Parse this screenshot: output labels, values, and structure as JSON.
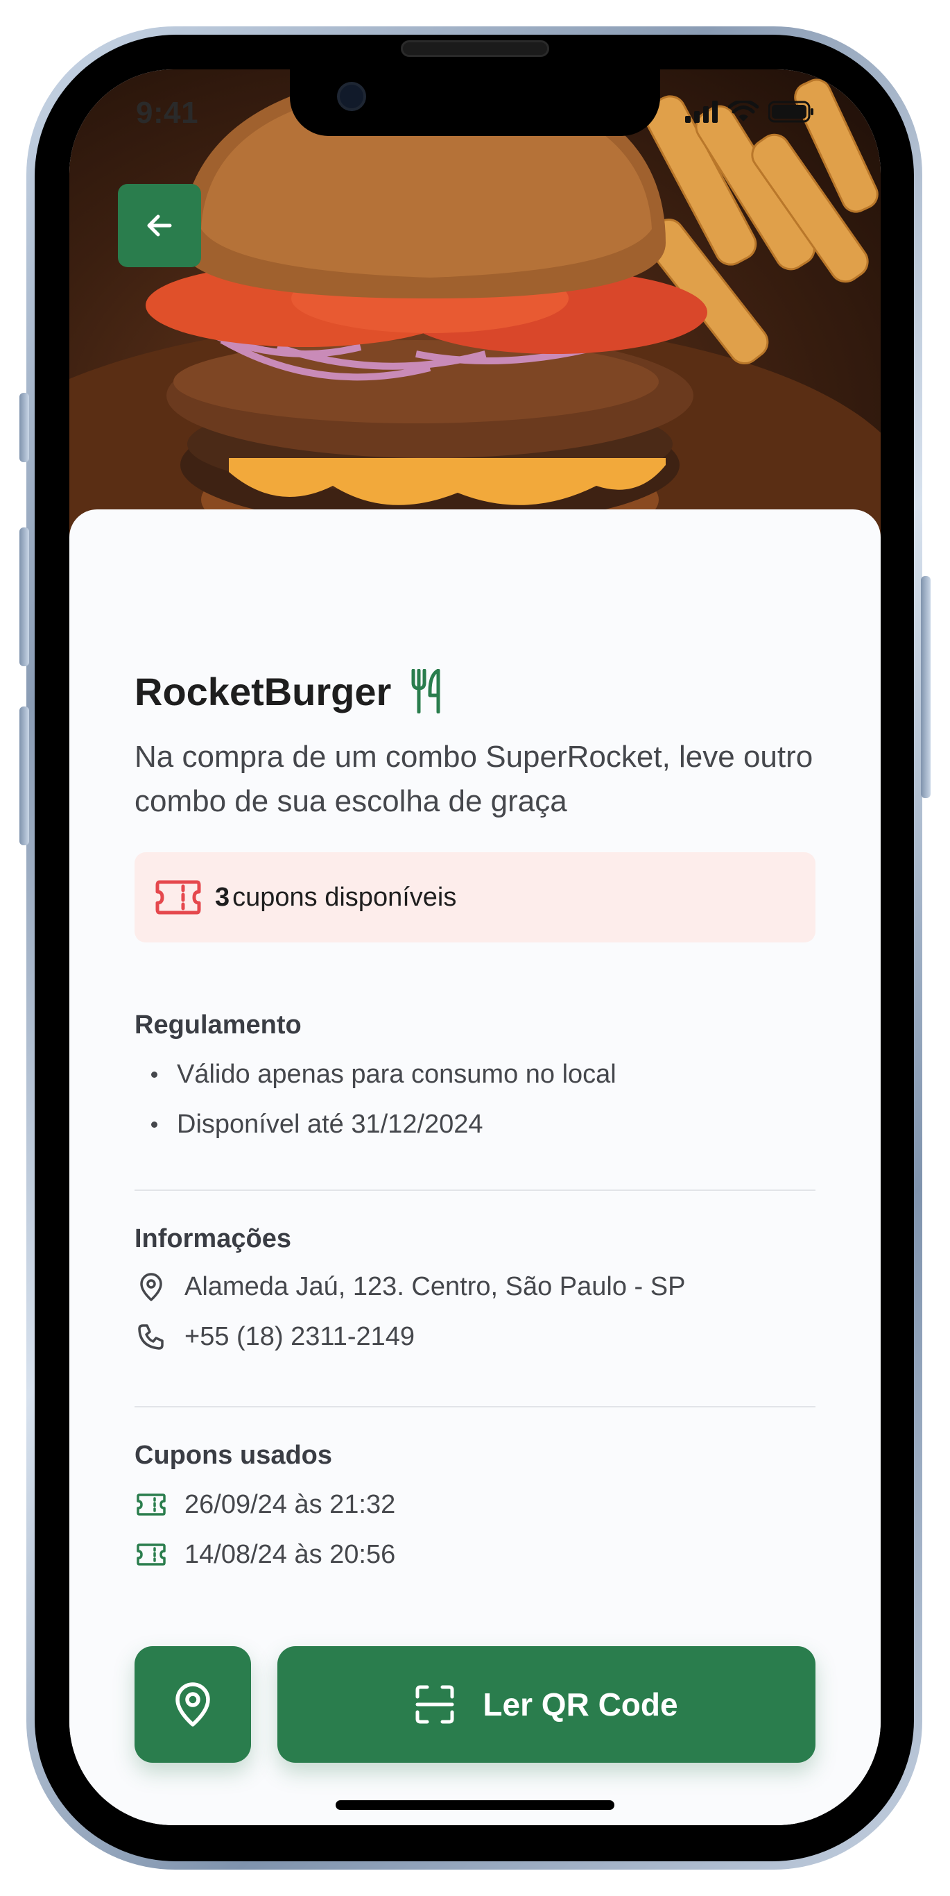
{
  "status_bar": {
    "time": "9:41"
  },
  "header": {
    "back_icon": "arrow-left-icon"
  },
  "market": {
    "name": "RocketBurger",
    "category_icon": "fork-knife-icon",
    "description": "Na compra de um combo SuperRocket, leve outro combo de sua escolha de graça"
  },
  "coupons": {
    "count": "3",
    "label": "cupons disponíveis",
    "icon": "ticket-icon"
  },
  "rules": {
    "title": "Regulamento",
    "items": [
      "Válido apenas para consumo no local",
      "Disponível até 31/12/2024"
    ]
  },
  "info": {
    "title": "Informações",
    "address": "Alameda Jaú, 123. Centro, São Paulo - SP",
    "phone": "+55 (18) 2311-2149"
  },
  "used_coupons": {
    "title": "Cupons usados",
    "items": [
      "26/09/24 às 21:32",
      "14/08/24 às 20:56"
    ]
  },
  "actions": {
    "map_icon": "map-pin-icon",
    "scan_icon": "scan-icon",
    "scan_label": "Ler QR Code"
  },
  "colors": {
    "primary": "#2A7D4D",
    "coupon_bg": "#FDEDEB",
    "coupon_icon": "#E5484D",
    "text": "#1E1E1E",
    "muted": "#45474C"
  }
}
